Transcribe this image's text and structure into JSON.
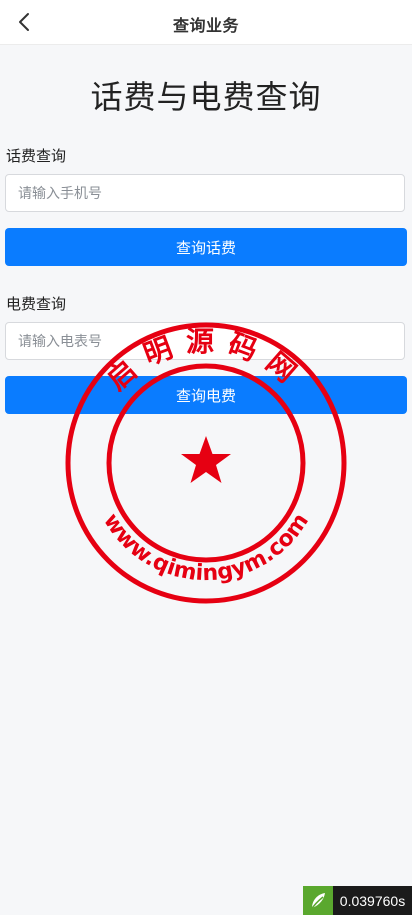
{
  "header": {
    "title": "查询业务",
    "back_icon": "chevron-left-icon"
  },
  "main": {
    "title": "话费与电费查询",
    "phone_section": {
      "label": "话费查询",
      "input_placeholder": "请输入手机号",
      "input_value": "",
      "button_label": "查询话费"
    },
    "electric_section": {
      "label": "电费查询",
      "input_placeholder": "请输入电表号",
      "input_value": "",
      "button_label": "查询电费"
    }
  },
  "watermark": {
    "top_text": "启明源码网",
    "bottom_text": "www.qimingym.com",
    "color": "#e60012"
  },
  "perf_badge": {
    "time_text": "0.039760s",
    "logo_icon": "leaf-logo-icon"
  },
  "colors": {
    "primary": "#0a7cff",
    "background": "#f6f7f9"
  }
}
